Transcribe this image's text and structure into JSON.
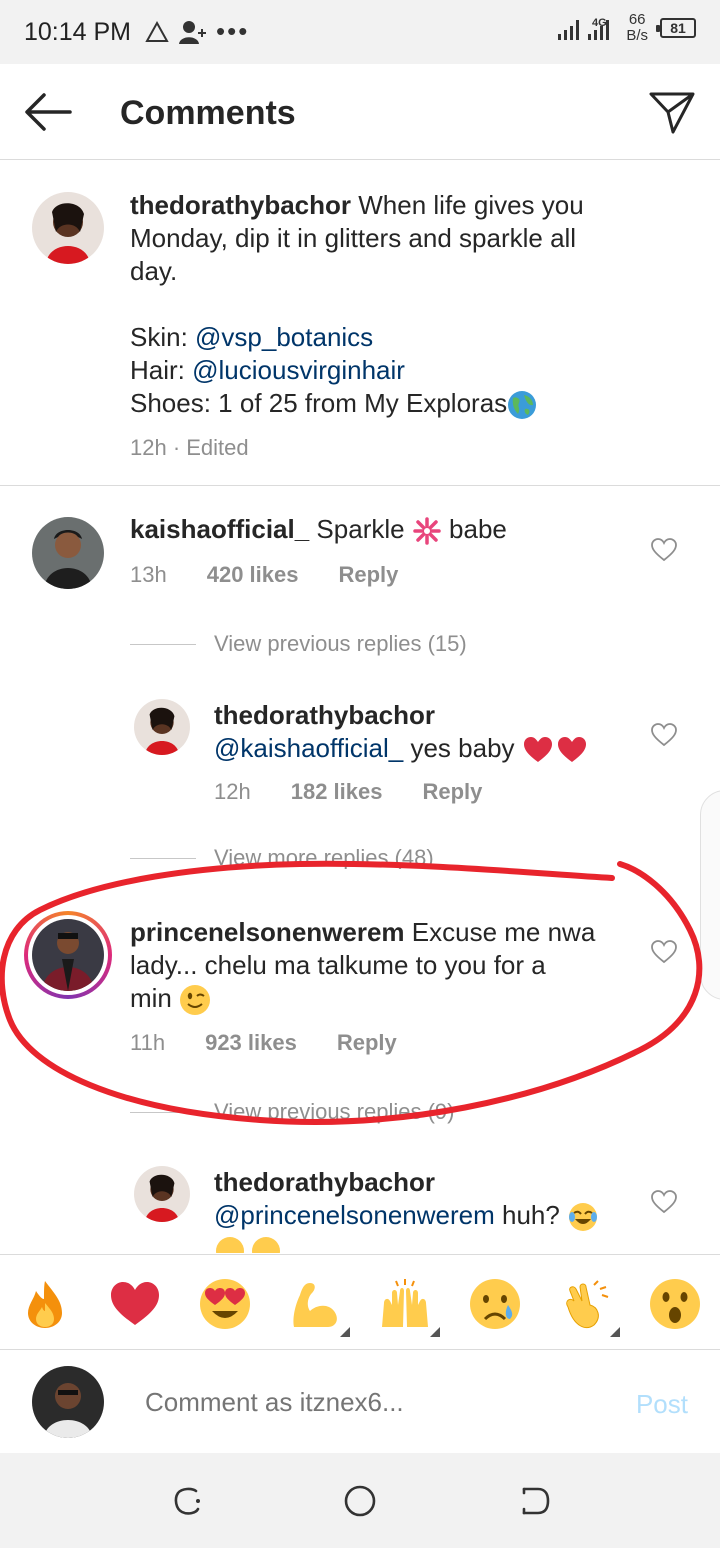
{
  "status_bar": {
    "time": "10:14 PM",
    "network": "4G",
    "speed_value": "66",
    "speed_unit": "B/s",
    "battery": "81"
  },
  "header": {
    "title": "Comments",
    "back_icon": "arrow-left-icon",
    "send_icon": "paper-plane-icon"
  },
  "caption": {
    "username": "thedorathybachor",
    "text_line1": " When life gives you",
    "text_line2": "Monday, dip it in glitters and sparkle all",
    "text_line3": "day.",
    "skin_label": "Skin: ",
    "skin_mention": "@vsp_botanics",
    "hair_label": "Hair: ",
    "hair_mention": "@luciousvirginhair",
    "shoes_text": "Shoes: 1 of 25 from My Exploras",
    "meta": "12h · Edited"
  },
  "comments": [
    {
      "username": "kaishaofficial_",
      "text_before": " Sparkle ",
      "text_after": " babe",
      "time": "13h",
      "likes": "420 likes",
      "reply": "Reply",
      "view_replies": "View previous replies (15)"
    },
    {
      "username": "thedorathybachor",
      "mention": "@kaishaofficial_",
      "text": " yes baby ",
      "time": "12h",
      "likes": "182 likes",
      "reply": "Reply",
      "view_replies": "View more replies (48)"
    },
    {
      "username": "princenelsonenwerem",
      "text_line1": " Excuse me nwa",
      "text_line2": "lady... chelu ma talkume to you for a",
      "text_line3": "min ",
      "time": "11h",
      "likes": "923 likes",
      "reply": "Reply",
      "view_replies": "View previous replies (9)"
    },
    {
      "username": "thedorathybachor",
      "mention": "@princenelsonenwerem",
      "text": " huh? "
    }
  ],
  "emoji_bar": [
    "fire",
    "red-heart",
    "heart-eyes",
    "flexed-biceps",
    "raising-hands",
    "crying-face",
    "clapping-hands",
    "astonished-face"
  ],
  "composer": {
    "placeholder": "Comment as itznex6...",
    "post": "Post"
  },
  "colors": {
    "mention": "#003569",
    "annotation": "#e8242c",
    "post_disabled": "#b2dffc"
  }
}
